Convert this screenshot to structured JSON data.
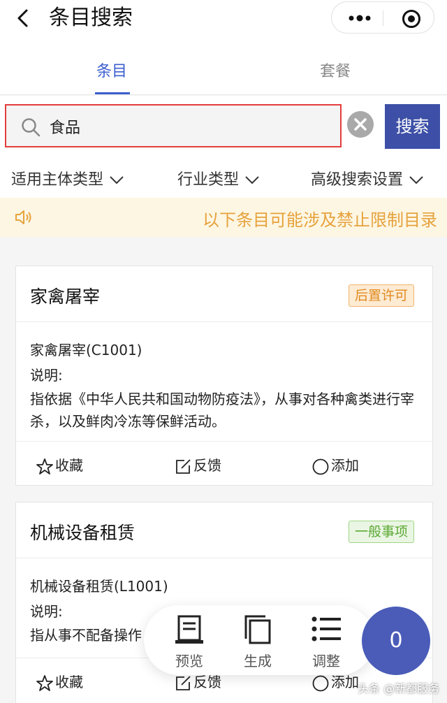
{
  "header": {
    "title": "条目搜索"
  },
  "tabs": [
    {
      "label": "条目"
    },
    {
      "label": "套餐"
    }
  ],
  "search": {
    "value": "食品",
    "button_label": "搜索"
  },
  "filters": [
    {
      "label": "适用主体类型"
    },
    {
      "label": "行业类型"
    },
    {
      "label": "高级搜索设置"
    }
  ],
  "notice": {
    "text": "以下条目可能涉及禁止限制目录"
  },
  "cards": [
    {
      "title": "家禽屠宰",
      "badge": "后置许可",
      "badge_color": "#e08a1e",
      "code": "家禽屠宰(C1001)",
      "desc_label": "说明:",
      "desc": "指依据《中华人民共和国动物防疫法》，从事对各种禽类进行宰杀，以及鲜肉冷冻等保鲜活动。",
      "actions": {
        "favorite": "收藏",
        "feedback": "反馈",
        "add": "添加"
      }
    },
    {
      "title": "机械设备租赁",
      "badge": "一般事项",
      "badge_color": "#5aa832",
      "code": "机械设备租赁(L1001)",
      "desc_label": "说明:",
      "desc": "指从事不配备操作",
      "actions": {
        "favorite": "收藏",
        "feedback": "反馈",
        "add": "添加"
      }
    }
  ],
  "floating_bar": {
    "preview": "预览",
    "generate": "生成",
    "adjust": "调整"
  },
  "cart": {
    "count": "0"
  },
  "watermark": "头条 @新都服务",
  "colors": {
    "accent": "#3d4fa6",
    "tab_active": "#3b5fd0",
    "notice_text": "#e6a23c",
    "search_border": "#e33c3c"
  }
}
